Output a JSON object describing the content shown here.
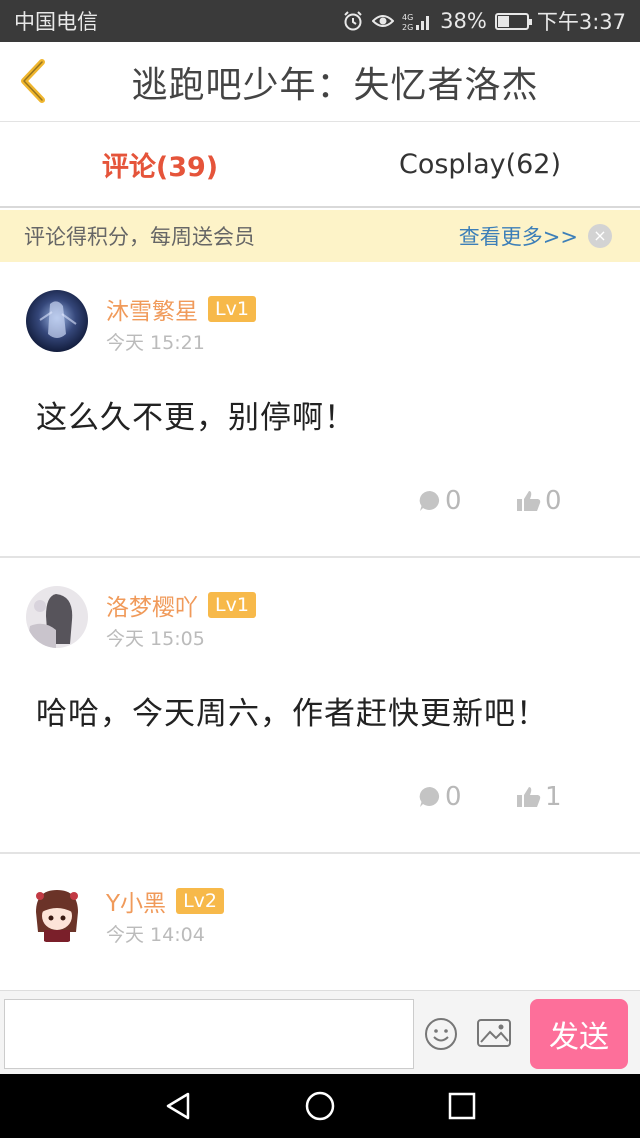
{
  "status_bar": {
    "carrier": "中国电信",
    "signal": "4G 2G",
    "battery": "38%",
    "battery_level": 0.38,
    "time": "下午3:37"
  },
  "header": {
    "back_icon": "chevron-left-icon",
    "title": "逃跑吧少年：失忆者洛杰"
  },
  "tabs": [
    {
      "label": "评论(39)",
      "active": true
    },
    {
      "label": "Cosplay(62)",
      "active": false
    }
  ],
  "banner": {
    "text": "评论得积分，每周送会员",
    "link": "查看更多>>",
    "close": "×"
  },
  "comments": [
    {
      "user": "沐雪繁星",
      "level": "Lv1",
      "time": "今天 15:21",
      "text": "这么久不更，别停啊！",
      "replies": "0",
      "likes": "0"
    },
    {
      "user": "洛梦樱吖",
      "level": "Lv1",
      "time": "今天 15:05",
      "text": "哈哈，今天周六，作者赶快更新吧！",
      "replies": "0",
      "likes": "1"
    },
    {
      "user": "Y小黑",
      "level": "Lv2",
      "time": "今天 14:04",
      "text": "",
      "replies": "",
      "likes": ""
    }
  ],
  "input_bar": {
    "placeholder": "",
    "send_label": "发送"
  },
  "colors": {
    "accent": "#e5543a",
    "username": "#f09a5a",
    "level_badge": "#f7b94a",
    "send_button": "#fd6f9a",
    "banner_bg": "#fdf3c8"
  }
}
